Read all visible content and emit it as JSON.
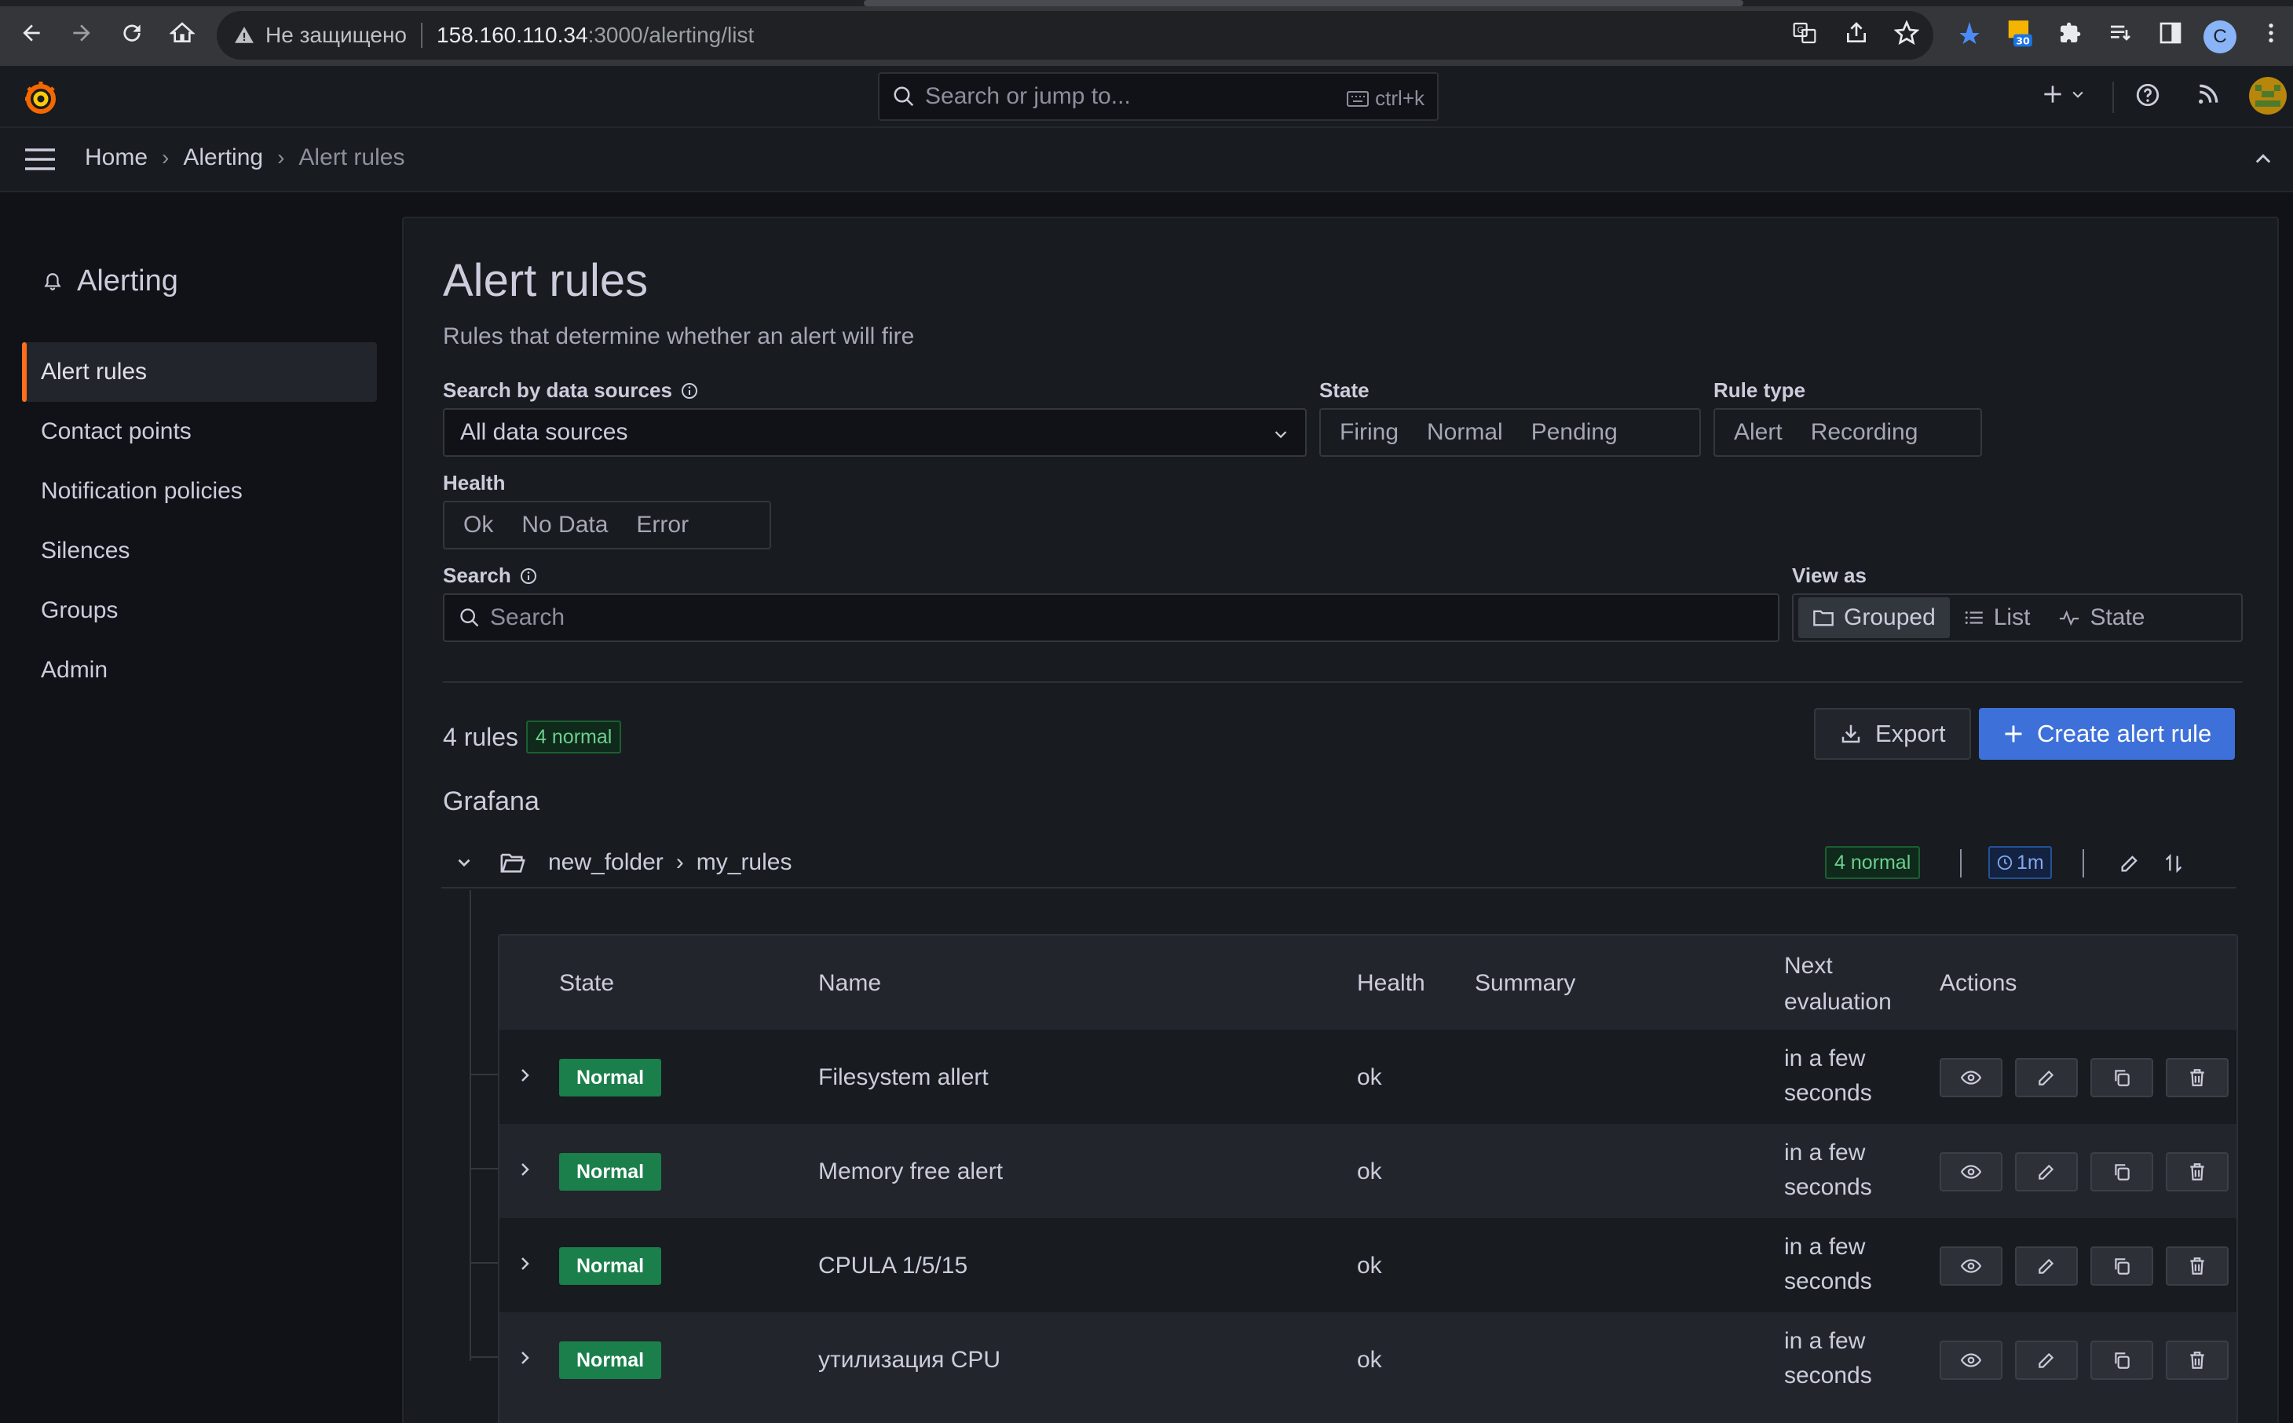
{
  "browser": {
    "security_label": "Не защищено",
    "url_host": "158.160.110.34",
    "url_path": ":3000/alerting/list",
    "extension_badge": "30",
    "profile_initial": "C"
  },
  "topbar": {
    "search_placeholder": "Search or jump to...",
    "shortcut": "ctrl+k"
  },
  "breadcrumb": [
    "Home",
    "Alerting",
    "Alert rules"
  ],
  "sidebar": {
    "title": "Alerting",
    "items": [
      {
        "label": "Alert rules",
        "active": true
      },
      {
        "label": "Contact points"
      },
      {
        "label": "Notification policies"
      },
      {
        "label": "Silences"
      },
      {
        "label": "Groups"
      },
      {
        "label": "Admin"
      }
    ]
  },
  "page": {
    "title": "Alert rules",
    "subtitle": "Rules that determine whether an alert will fire"
  },
  "filters": {
    "datasource_label": "Search by data sources",
    "datasource_value": "All data sources",
    "state_label": "State",
    "state_options": [
      "Firing",
      "Normal",
      "Pending"
    ],
    "ruletype_label": "Rule type",
    "ruletype_options": [
      "Alert",
      "Recording"
    ],
    "health_label": "Health",
    "health_options": [
      "Ok",
      "No Data",
      "Error"
    ],
    "search_label": "Search",
    "search_placeholder": "Search",
    "viewas_label": "View as",
    "viewas_options": [
      "Grouped",
      "List",
      "State"
    ],
    "viewas_selected": "Grouped"
  },
  "summary": {
    "rules_count": "4 rules",
    "normal_badge": "4 normal",
    "export_label": "Export",
    "create_label": "Create alert rule"
  },
  "section": "Grafana",
  "group": {
    "folder": "new_folder",
    "name": "my_rules",
    "normal_badge": "4 normal",
    "interval": "1m"
  },
  "table": {
    "headers": {
      "state": "State",
      "name": "Name",
      "health": "Health",
      "summary": "Summary",
      "next_eval_1": "Next",
      "next_eval_2": "evaluation",
      "actions": "Actions"
    },
    "rows": [
      {
        "state": "Normal",
        "name": "Filesystem allert",
        "health": "ok",
        "next_1": "in a few",
        "next_2": "seconds"
      },
      {
        "state": "Normal",
        "name": "Memory free alert",
        "health": "ok",
        "next_1": "in a few",
        "next_2": "seconds"
      },
      {
        "state": "Normal",
        "name": "CPULA 1/5/15",
        "health": "ok",
        "next_1": "in a few",
        "next_2": "seconds"
      },
      {
        "state": "Normal",
        "name": "утилизация CPU",
        "health": "ok",
        "next_1": "in a few",
        "next_2": "seconds"
      }
    ]
  },
  "colors": {
    "accent_orange": "#ff6e1c",
    "primary_blue": "#3d71d9",
    "normal_green": "#1a7f4b"
  }
}
